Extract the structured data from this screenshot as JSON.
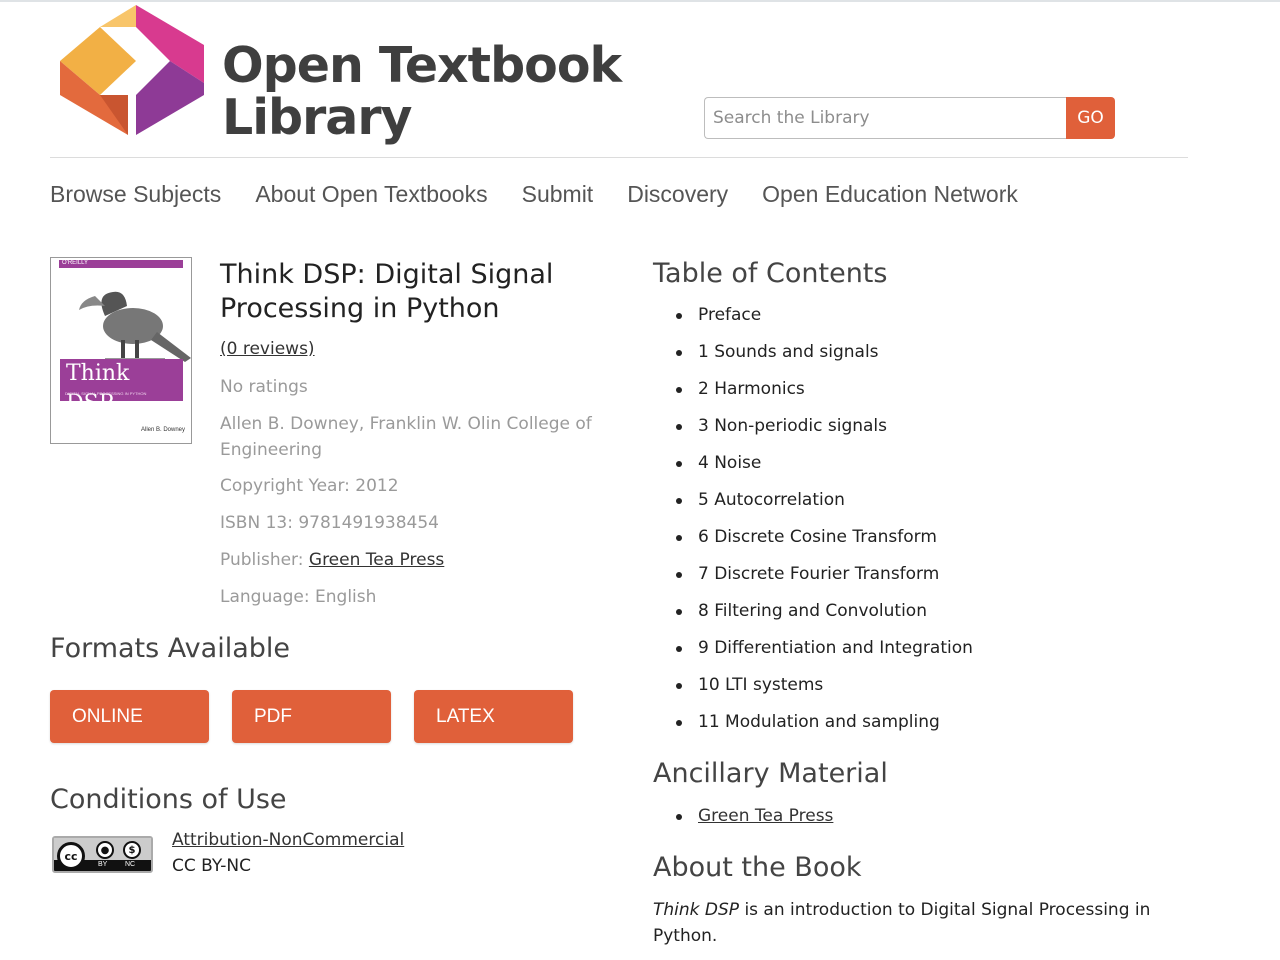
{
  "header": {
    "logo_line1": "Open Textbook",
    "logo_line2": "Library",
    "search_placeholder": "Search the Library",
    "search_button": "GO",
    "colors": {
      "accent": "#e0603a",
      "logo_yellow": "#f2b045",
      "logo_magenta": "#d83a8f",
      "logo_purple": "#8e3a96",
      "logo_orange": "#e36a3d"
    }
  },
  "nav": {
    "items": [
      {
        "label": "Browse Subjects"
      },
      {
        "label": "About Open Textbooks"
      },
      {
        "label": "Submit"
      },
      {
        "label": "Discovery"
      },
      {
        "label": "Open Education Network"
      }
    ]
  },
  "book": {
    "cover": {
      "publisher_band": "O'REILLY",
      "title": "Think DSP",
      "subtitle": "DIGITAL SIGNAL PROCESSING IN PYTHON",
      "author": "Allen B. Downey"
    },
    "title": "Think DSP: Digital Signal Processing in Python",
    "reviews": "(0 reviews)",
    "ratings": "No ratings",
    "authors": "Allen B. Downey, Franklin W. Olin College of Engineering",
    "copyright": "Copyright Year: 2012",
    "isbn": "ISBN 13: 9781491938454",
    "publisher_label": "Publisher: ",
    "publisher_name": "Green Tea Press",
    "language": "Language: English"
  },
  "formats": {
    "heading": "Formats Available",
    "buttons": [
      {
        "label": "ONLINE"
      },
      {
        "label": "PDF"
      },
      {
        "label": "LATEX"
      }
    ]
  },
  "conditions": {
    "heading": "Conditions of Use",
    "badge": {
      "cc": "cc",
      "by": "BY",
      "nc": "NC"
    },
    "license_name": "Attribution-NonCommercial",
    "license_code": "CC BY-NC"
  },
  "toc": {
    "heading": "Table of Contents",
    "items": [
      "Preface",
      "1 Sounds and signals",
      "2 Harmonics",
      "3 Non-periodic signals",
      "4 Noise",
      "5 Autocorrelation",
      "6 Discrete Cosine Transform",
      "7 Discrete Fourier Transform",
      "8 Filtering and Convolution",
      "9 Differentiation and Integration",
      "10 LTI systems",
      "11 Modulation and sampling"
    ]
  },
  "ancillary": {
    "heading": "Ancillary Material",
    "items": [
      "Green Tea Press"
    ]
  },
  "about": {
    "heading": "About the Book",
    "title_em": "Think DSP",
    "text": " is an introduction to Digital Signal Processing in Python."
  }
}
